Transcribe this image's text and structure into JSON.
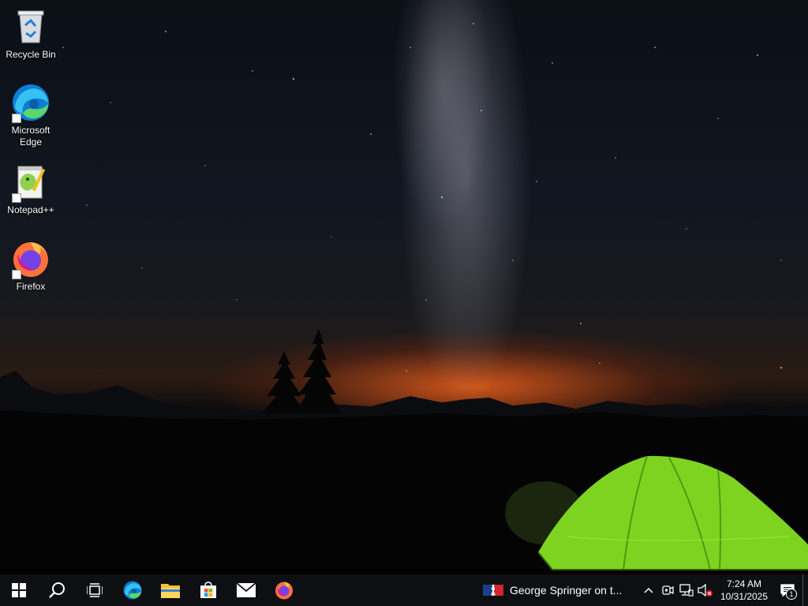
{
  "desktop": {
    "icons": [
      {
        "label": "Recycle Bin",
        "icon": "recycle-bin-icon"
      },
      {
        "label": "Microsoft Edge",
        "icon": "edge-icon"
      },
      {
        "label": "Notepad++",
        "icon": "notepad-plus-plus-icon"
      },
      {
        "label": "Firefox",
        "icon": "firefox-icon"
      }
    ],
    "wallpaper": "night-sky-milky-way-tent"
  },
  "taskbar": {
    "start": "start-icon",
    "search": "search-icon",
    "task_view": "task-view-icon",
    "pinned": [
      {
        "name": "Microsoft Edge",
        "icon": "edge-icon"
      },
      {
        "name": "File Explorer",
        "icon": "folder-icon"
      },
      {
        "name": "Microsoft Store",
        "icon": "store-icon"
      },
      {
        "name": "Mail",
        "icon": "mail-icon"
      },
      {
        "name": "Firefox",
        "icon": "firefox-icon"
      }
    ],
    "news_text": "George Springer on t...",
    "news_icon": "mlb-icon",
    "tray": {
      "chevron": "chevron-up-icon",
      "meet_now": "meet-now-icon",
      "network": "network-icon",
      "volume": "volume-muted-icon"
    },
    "clock": {
      "time": "7:24 AM",
      "date": "10/31/2025"
    },
    "notifications_count": "1"
  },
  "colors": {
    "taskbar_bg": "#0e0f12",
    "tent_green": "#7ed321",
    "horizon_orange": "#ec601c"
  }
}
